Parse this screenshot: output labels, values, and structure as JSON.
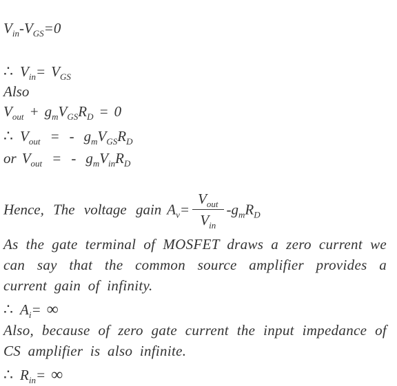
{
  "equations": {
    "eq1": {
      "v": "V",
      "in_sub": "in",
      "minus": "-",
      "v2": "V",
      "gs_sub": "GS",
      "rhs": "=0"
    },
    "eq2": {
      "therefore": "∴",
      "v": "V",
      "in_sub": "in",
      "eq": "=",
      "v2": "V",
      "gs_sub": "GS"
    },
    "also_label": "Also",
    "eq3": {
      "v": "V",
      "out_sub": "out",
      "plus": "+",
      "g": "g",
      "m_sub": "m",
      "v2": "V",
      "gs_sub": "GS",
      "r": "R",
      "d_sub": "D",
      "eq": "=",
      "rhs": "0"
    },
    "eq4": {
      "therefore": "∴",
      "v": "V",
      "out_sub": "out",
      "eq": "=",
      "minus": "-",
      "g": "g",
      "m_sub": "m",
      "v2": "V",
      "gs_sub": "GS",
      "r": "R",
      "d_sub": "D"
    },
    "eq5": {
      "prefix": "or",
      "v": "V",
      "out_sub": "out",
      "eq": "=",
      "minus": "-",
      "g": "g",
      "m_sub": "m",
      "v2": "V",
      "in_sub": "in",
      "r": "R",
      "d_sub": "D"
    },
    "eq6": {
      "prefix": "Hence, The voltage gain",
      "a": "A",
      "v_sub": "v",
      "eq": "=",
      "num_v": "V",
      "num_sub": "out",
      "den_v": "V",
      "den_sub": "in",
      "rest": "-g",
      "m_sub": "m",
      "r": "R",
      "d_sub": "D"
    },
    "eq7": {
      "therefore": "∴",
      "a": "A",
      "i_sub": "i",
      "eq": "=",
      "infinity": "∞"
    },
    "eq8": {
      "therefore": "∴",
      "r": "R",
      "in_sub": "in",
      "eq": "=",
      "infinity": "∞"
    }
  },
  "paragraphs": {
    "p1": "As the gate terminal of MOSFET draws a zero current we can say that the common source amplifier provides a current gain of infinity.",
    "p2": "Also, because of zero gate current the input impedance of CS amplifier is also infinite."
  }
}
